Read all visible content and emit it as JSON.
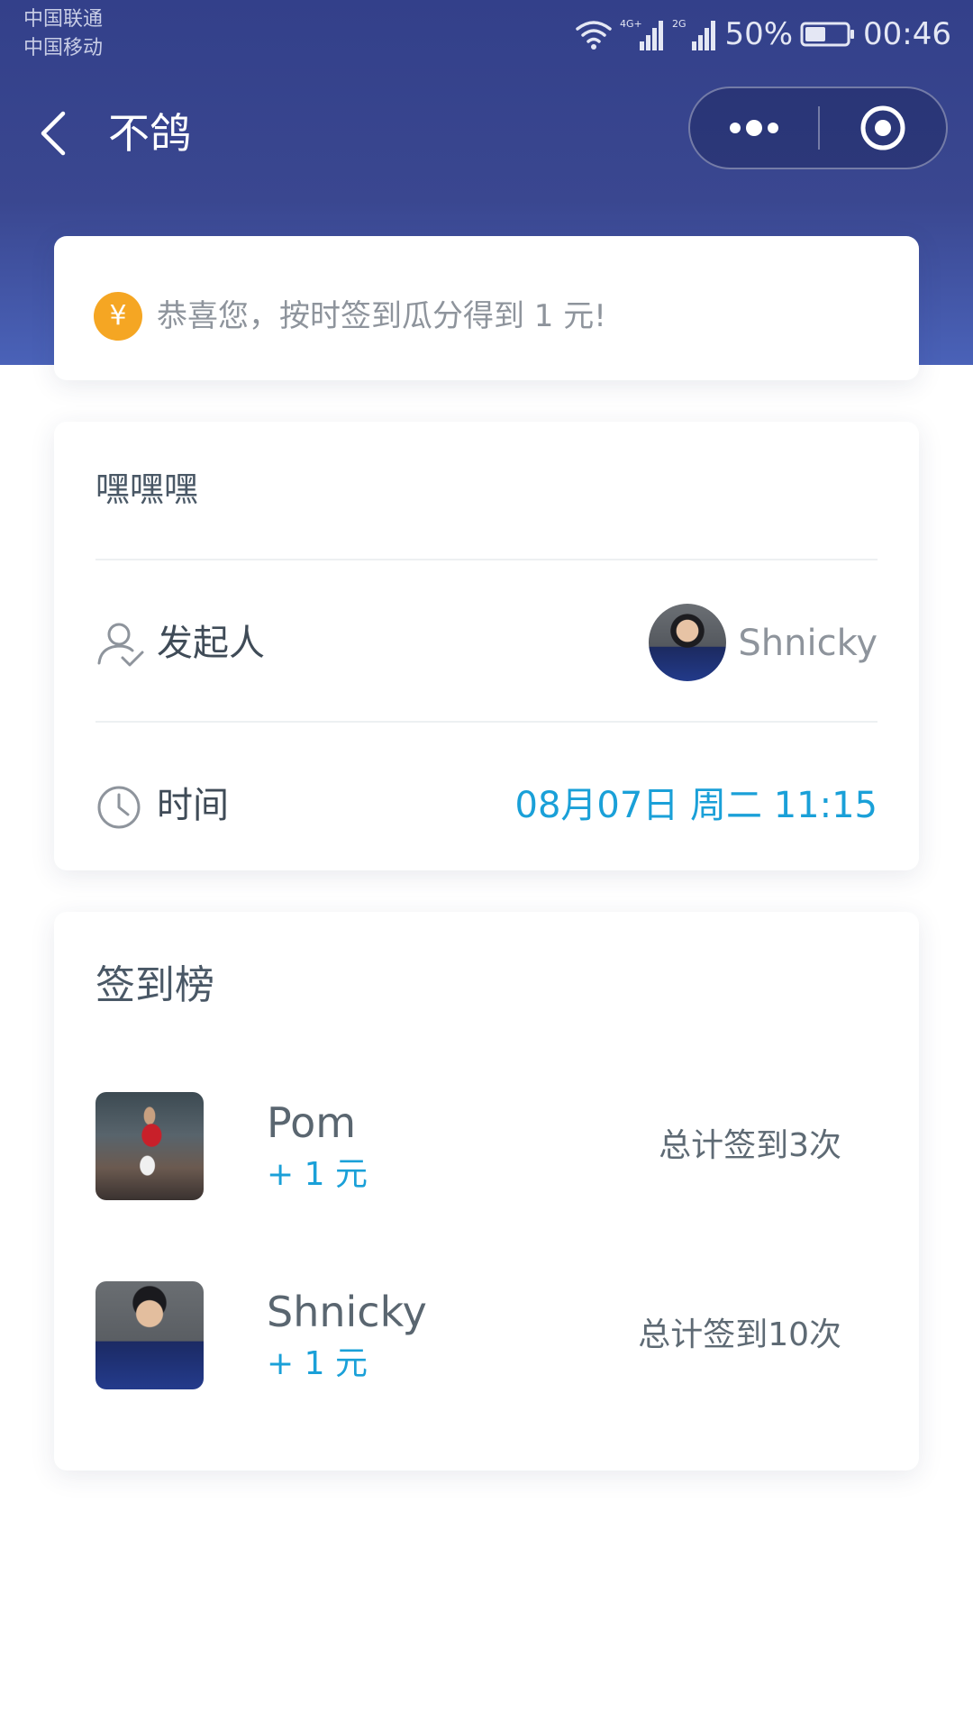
{
  "status_bar": {
    "carrier_1": "中国联通",
    "carrier_2": "中国移动",
    "battery": "50%",
    "time": "00:46"
  },
  "nav": {
    "title": "不鸽",
    "back_icon": "chevron-left-icon",
    "more_icon": "more-dots-icon",
    "close_icon": "target-circle-icon"
  },
  "notice": {
    "icon": "yen-coin-icon",
    "icon_glyph": "¥",
    "text": "恭喜您，按时签到瓜分得到 1 元!"
  },
  "event": {
    "title": "嘿嘿嘿",
    "creator_label": "发起人",
    "creator_name": "Shnicky",
    "time_label": "时间",
    "time_value": "08月07日 周二 11:15"
  },
  "ranking": {
    "title": "签到榜",
    "items": [
      {
        "name": "Pom",
        "reward": "+ 1 元",
        "count": "总计签到3次"
      },
      {
        "name": "Shnicky",
        "reward": "+ 1 元",
        "count": "总计签到10次"
      }
    ]
  },
  "colors": {
    "header": "#33408a",
    "accent_blue": "#1aa0d8",
    "coin": "#f5a623"
  }
}
